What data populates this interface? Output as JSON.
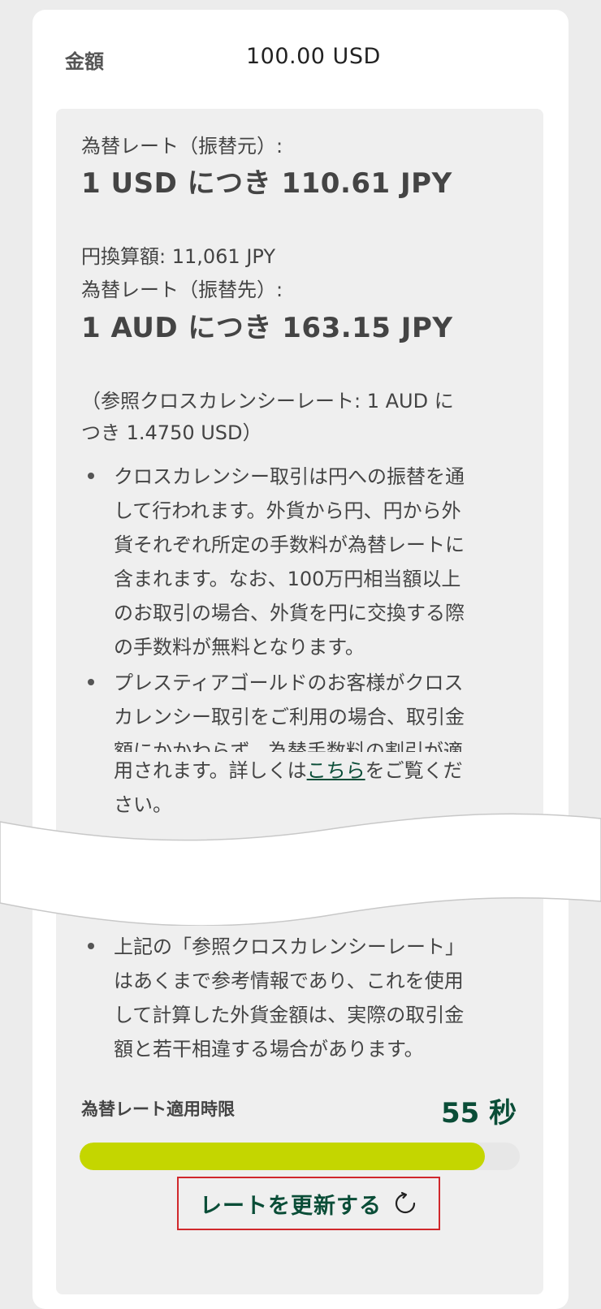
{
  "amount": {
    "label": "金額",
    "value": "100.00 USD"
  },
  "rate_from": {
    "label": "為替レート（振替元）:",
    "value": "1 USD につき 110.61 JPY"
  },
  "yen_equivalent": "円換算額: 11,061 JPY",
  "rate_to": {
    "label": "為替レート（振替先）:",
    "value": "1 AUD につき 163.15 JPY"
  },
  "cross_rate": {
    "line1": "（参照クロスカレンシーレート: 1 AUD に",
    "line2": "つき 1.4750 USD）"
  },
  "notes": {
    "n1": [
      "クロスカレンシー取引は円への振替を通",
      "して行われます。外貨から円、円から外",
      "貨それぞれ所定の手数料が為替レートに",
      "含まれます。なお、100万円相当額以上",
      "のお取引の場合、外貨を円に交換する際",
      "の手数料が無料となります。"
    ],
    "n2": {
      "l1": "プレスティアゴールドのお客様がクロス",
      "l2": "カレンシー取引をご利用の場合、取引金",
      "l3": "額にかかわらず、為替手数料の割引が適",
      "l4_prefix": "用されます。詳しくは",
      "link": "こちら",
      "l4_suffix": "をご覧くだ",
      "l5": "さい。"
    },
    "n3": [
      "上記の「参照クロスカレンシーレート」",
      "はあくまで参考情報であり、これを使用",
      "して計算した外貨金額は、実際の取引金",
      "額と若干相違する場合があります。"
    ]
  },
  "time_limit": {
    "label": "為替レート適用時限",
    "value": "55 秒",
    "progress": 0.92
  },
  "refresh": {
    "label": "レートを更新する",
    "icon": "refresh-icon"
  },
  "colors": {
    "accent": "#0a4d37",
    "bar": "#c4d600",
    "highlight_border": "#d0282c"
  }
}
